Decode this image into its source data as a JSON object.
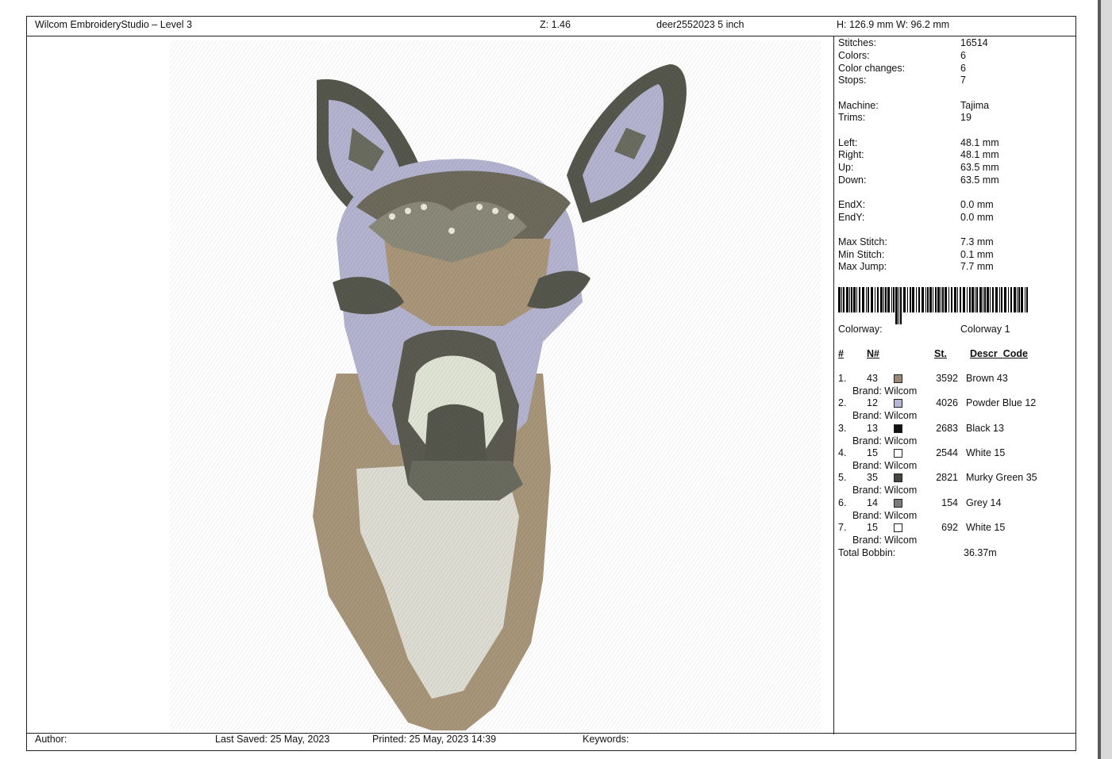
{
  "header": {
    "app_title": "Wilcom EmbroideryStudio – Level 3",
    "zoom": "Z: 1.46",
    "design_name": "deer2552023 5 inch",
    "size": "H: 126.9 mm   W: 96.2 mm"
  },
  "stats": [
    {
      "label": "Stitches:",
      "value": "16514"
    },
    {
      "label": "Colors:",
      "value": "6"
    },
    {
      "label": "Color changes:",
      "value": "6"
    },
    {
      "label": "Stops:",
      "value": "7"
    },
    {
      "label": "Machine:",
      "value": "Tajima"
    },
    {
      "label": "Trims:",
      "value": "19"
    },
    {
      "label": "Left:",
      "value": "48.1 mm"
    },
    {
      "label": "Right:",
      "value": "48.1 mm"
    },
    {
      "label": "Up:",
      "value": "63.5 mm"
    },
    {
      "label": "Down:",
      "value": "63.5 mm"
    },
    {
      "label": "EndX:",
      "value": "0.0 mm"
    },
    {
      "label": "EndY:",
      "value": "0.0 mm"
    },
    {
      "label": "Max Stitch:",
      "value": "7.3 mm"
    },
    {
      "label": "Min Stitch:",
      "value": "0.1 mm"
    },
    {
      "label": "Max Jump:",
      "value": "7.7 mm"
    }
  ],
  "colorway": {
    "label": "Colorway:",
    "value": "Colorway 1"
  },
  "table_headers": {
    "index": "#",
    "number": "N#",
    "stitches": "St.",
    "descr": "Descr_Code"
  },
  "colors": [
    {
      "idx": "1.",
      "n": "43",
      "st": "3592",
      "descr": "Brown 43",
      "brand": "Brand: Wilcom",
      "swatch": "#9b8877"
    },
    {
      "idx": "2.",
      "n": "12",
      "st": "4026",
      "descr": "Powder Blue 12",
      "brand": "Brand: Wilcom",
      "swatch": "#b8b6d6"
    },
    {
      "idx": "3.",
      "n": "13",
      "st": "2683",
      "descr": "Black 13",
      "brand": "Brand: Wilcom",
      "swatch": "#111111"
    },
    {
      "idx": "4.",
      "n": "15",
      "st": "2544",
      "descr": "White 15",
      "brand": "Brand: Wilcom",
      "swatch": "#ffffff"
    },
    {
      "idx": "5.",
      "n": "35",
      "st": "2821",
      "descr": "Murky Green 35",
      "brand": "Brand: Wilcom",
      "swatch": "#45463f"
    },
    {
      "idx": "6.",
      "n": "14",
      "st": "154",
      "descr": "Grey 14",
      "brand": "Brand: Wilcom",
      "swatch": "#7b7b7b"
    },
    {
      "idx": "7.",
      "n": "15",
      "st": "692",
      "descr": "White 15",
      "brand": "Brand: Wilcom",
      "swatch": "#ffffff"
    }
  ],
  "bobbin": {
    "label": "Total Bobbin:",
    "value": "36.37m"
  },
  "footer": {
    "author": "Author:",
    "last_saved": "Last Saved: 25 May, 2023",
    "printed": "Printed: 25 May, 2023 14:39",
    "keywords": "Keywords:"
  }
}
